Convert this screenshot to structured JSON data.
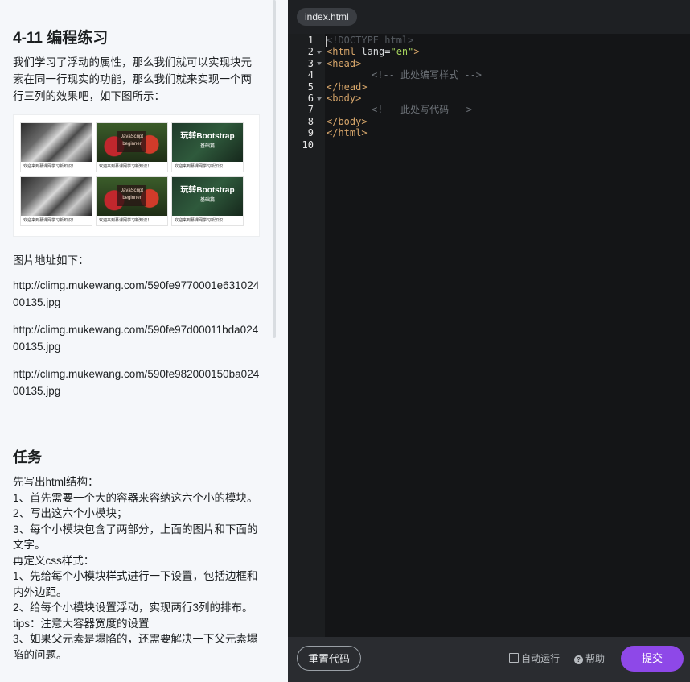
{
  "lesson": {
    "title": "4-11 编程练习",
    "intro": "我们学习了浮动的属性，那么我们就可以实现块元素在同一行现实的功能，那么我们就来实现一个两行三列的效果吧，如下图所示：",
    "example_caption": "欢迎来到慕课网学习新知识！",
    "example_js_title": "JavaScript",
    "example_js_sub": "beginner",
    "example_bs_title": "玩转Bootstrap",
    "example_bs_sub": "基础篇",
    "urls_heading": "图片地址如下：",
    "urls": [
      "http://climg.mukewang.com/590fe9770001e63102400135.jpg",
      "http://climg.mukewang.com/590fe97d00011bda02400135.jpg",
      "http://climg.mukewang.com/590fe982000150ba02400135.jpg"
    ]
  },
  "task": {
    "title": "任务",
    "lines": [
      "先写出html结构：",
      "1、首先需要一个大的容器来容纳这六个小的模块。",
      "2、写出这六个小模块；",
      "3、每个小模块包含了两部分，上面的图片和下面的文字。",
      "再定义css样式：",
      "1、先给每个小模块样式进行一下设置，包括边框和内外边距。",
      "2、给每个小模块设置浮动，实现两行3列的排布。",
      "tips：注意大容器宽度的设置",
      "3、如果父元素是塌陷的，还需要解决一下父元素塌陷的问题。"
    ]
  },
  "editor": {
    "tab": "index.html",
    "line_numbers": [
      "1",
      "2",
      "3",
      "4",
      "5",
      "6",
      "7",
      "8",
      "9",
      "10"
    ],
    "code": {
      "l1": "<!DOCTYPE html>",
      "l2_tag_open": "<html ",
      "l2_attr": "lang=",
      "l2_str": "\"en\"",
      "l2_close": ">",
      "l3": "<head>",
      "l4": "<!-- 此处编写样式 -->",
      "l5": "</head>",
      "l6": "<body>",
      "l7": "<!-- 此处写代码 -->",
      "l8": "</body>",
      "l9": "</html>"
    }
  },
  "toolbar": {
    "reset_label": "重置代码",
    "autorun_label": "自动运行",
    "help_label": "帮助",
    "submit_label": "提交"
  },
  "colors": {
    "accent": "#8e48e8",
    "editor_bg": "#141517",
    "tag": "#d6a56a",
    "string": "#a5d25c",
    "comment": "#6d7278"
  }
}
